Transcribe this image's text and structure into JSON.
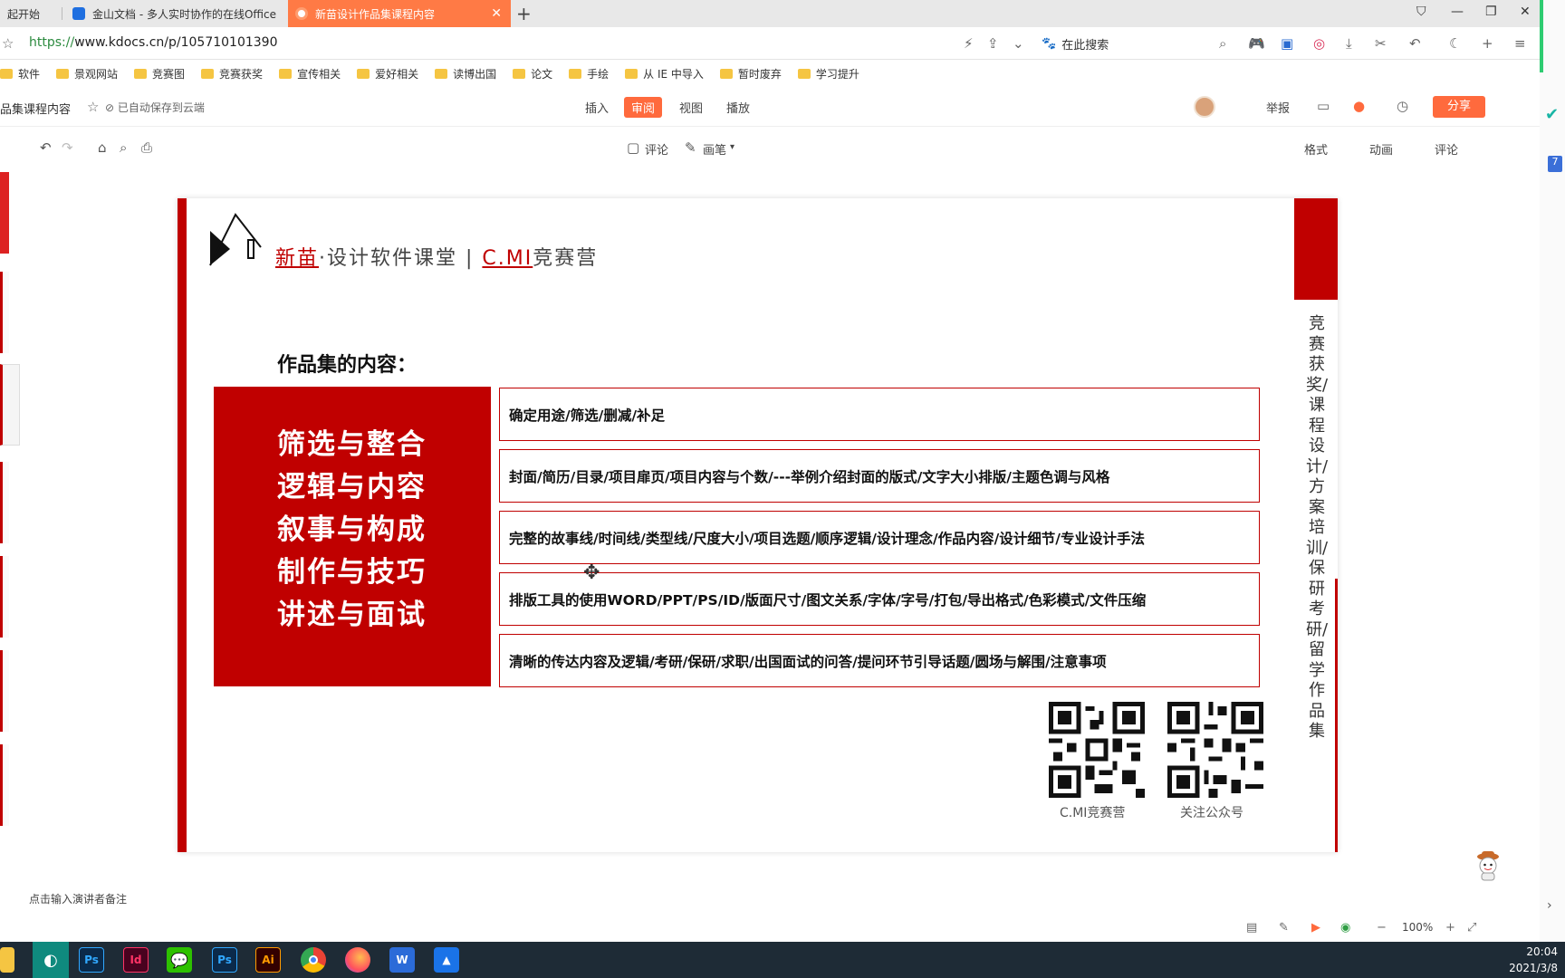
{
  "browser": {
    "tabs": [
      {
        "label": "起开始"
      },
      {
        "label": "金山文档 - 多人实时协作的在线Office"
      },
      {
        "label": "新苗设计作品集课程内容"
      }
    ],
    "url_scheme": "https://",
    "url_rest": "www.kdocs.cn/p/105710101390",
    "search_placeholder": "在此搜索",
    "bookmarks": [
      "软件",
      "景观网站",
      "竞赛图",
      "竞赛获奖",
      "宣传相关",
      "爱好相关",
      "读博出国",
      "论文",
      "手绘",
      "从 IE 中导入",
      "暂时废弃",
      "学习提升"
    ]
  },
  "doc_toolbar": {
    "title": "品集课程内容",
    "saved_status": "已自动保存到云端",
    "menu": [
      "插入",
      "审阅",
      "视图",
      "播放"
    ],
    "active_menu": "审阅",
    "report": "举报",
    "share": "分享"
  },
  "sub_toolbar": {
    "comment": "评论",
    "pen": "画笔",
    "right_tabs": [
      "格式",
      "动画",
      "评论"
    ]
  },
  "slide": {
    "brand_red1": "新苗",
    "brand_mid": "·设计软件课堂 | ",
    "brand_red2": "C.MI",
    "brand_end": "竞赛营",
    "content_title": "作品集的内容：",
    "left_lines": [
      "筛选与整合",
      "逻辑与内容",
      "叙事与构成",
      "制作与技巧",
      "讲述与面试"
    ],
    "rows": [
      "确定用途/筛选/删减/补足",
      "封面/简历/目录/项目扉页/项目内容与个数/---举例介绍封面的版式/文字大小排版/主题色调与风格",
      "完整的故事线/时间线/类型线/尺度大小/项目选题/顺序逻辑/设计理念/作品内容/设计细节/专业设计手法",
      "排版工具的使用WORD/PPT/PS/ID/版面尺寸/图文关系/字体/字号/打包/导出格式/色彩模式/文件压缩",
      "清晰的传达内容及逻辑/考研/保研/求职/出国面试的问答/提问环节引导话题/圆场与解围/注意事项"
    ],
    "qr_labels": [
      "C.MI竞赛营",
      "关注公众号"
    ],
    "vertical_text": "竞赛获奖/课程设计/方案培训/保研考研/留学作品集"
  },
  "notes_placeholder": "点击输入演讲者备注",
  "status": {
    "zoom": "100%"
  },
  "taskbar": {
    "time": "20:04",
    "date": "2021/3/8",
    "apps": [
      "Ps",
      "Id",
      "Ps",
      "Ai"
    ]
  },
  "colors": {
    "accent": "#ff6a3d",
    "slide_red": "#c00000",
    "taskbar": "#1e2b36"
  }
}
